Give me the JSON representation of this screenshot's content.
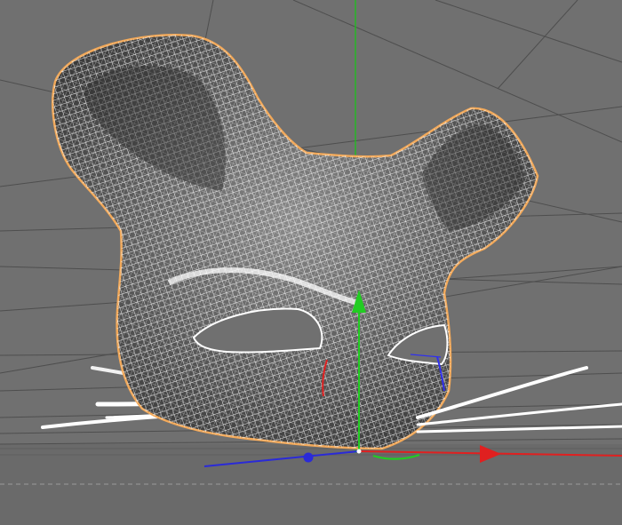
{
  "viewport": {
    "mode": "wireframe-3d",
    "object": "cat-mask-mesh",
    "background": "#6f6f6f",
    "floor_color": "#6b6b6b",
    "mesh_wire_color": "#ffffff",
    "mesh_shadow_color": "#3c3c3c",
    "selection_outline_color": "#f2a95a",
    "axes": {
      "x_color": "#e02020",
      "y_color": "#22cc22",
      "z_color": "#2020ee"
    },
    "gizmo_icons": [
      "move-arrow-y-icon",
      "move-arrow-x-icon",
      "move-handle-z-icon",
      "rotate-ring-icon"
    ]
  }
}
